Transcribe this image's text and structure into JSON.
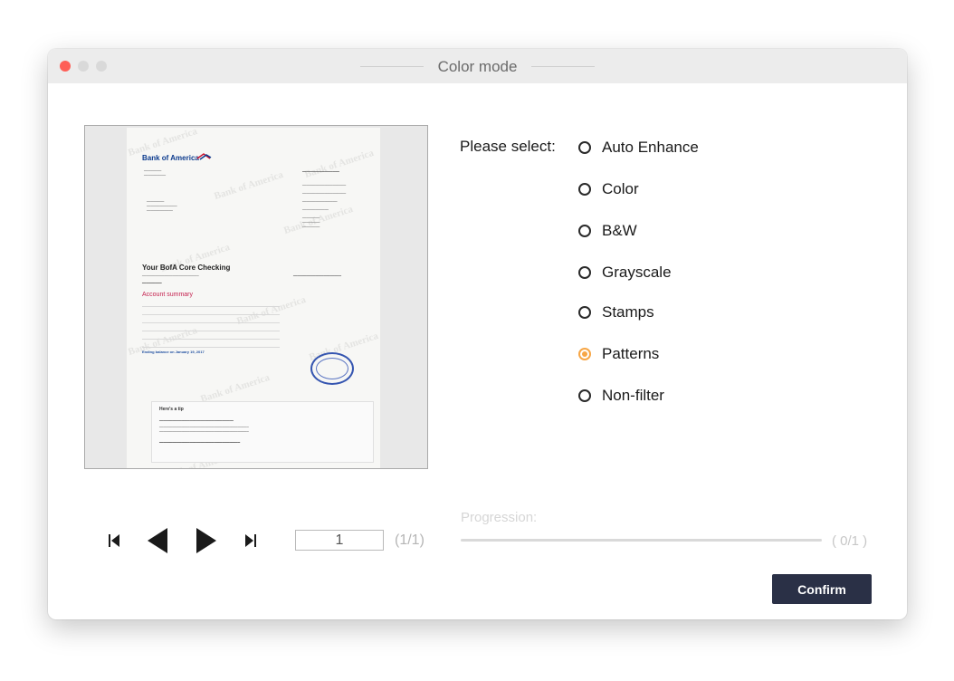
{
  "window": {
    "title": "Color mode"
  },
  "preview": {
    "bank_logo": "Bank of America",
    "watermark": "Bank of America",
    "doc_title": "Your BofA Core Checking",
    "account_summary": "Account summary",
    "ending_balance": "Ending balance on January 19, 2017",
    "tip_heading": "Here's a tip"
  },
  "selection": {
    "label": "Please select:",
    "selected": "Patterns",
    "options": [
      "Auto Enhance",
      "Color",
      "B&W",
      "Grayscale",
      "Stamps",
      "Patterns",
      "Non-filter"
    ]
  },
  "navigation": {
    "page_value": "1",
    "page_count": "(1/1)"
  },
  "progress": {
    "label": "Progression:",
    "count": "( 0/1 )",
    "fraction": 0
  },
  "actions": {
    "confirm_label": "Confirm"
  },
  "colors": {
    "accent": "#f7a646",
    "button": "#2a3046",
    "close": "#fe5f57"
  }
}
